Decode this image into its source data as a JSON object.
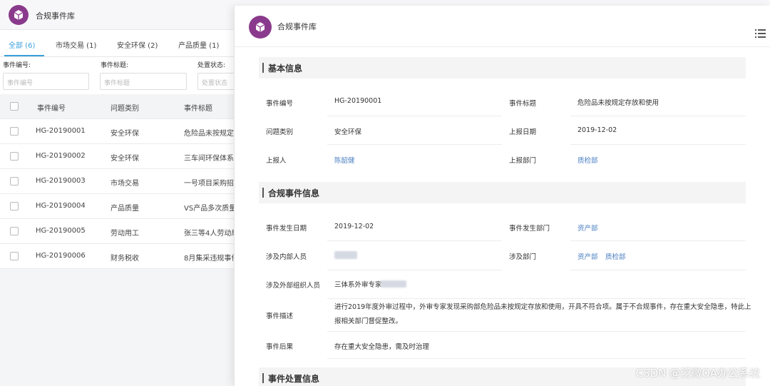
{
  "app": {
    "title": "合规事件库",
    "brand_color": "#8a3a8c",
    "accent_color": "#3aa0dc",
    "link_color": "#4a7fc1"
  },
  "tabs": [
    {
      "label": "全部 (6)",
      "active": true
    },
    {
      "label": "市场交易 (1)",
      "active": false
    },
    {
      "label": "安全环保 (2)",
      "active": false
    },
    {
      "label": "产品质量 (1)",
      "active": false
    }
  ],
  "filters": [
    {
      "label": "事件编号:",
      "placeholder": "事件编号"
    },
    {
      "label": "事件标题:",
      "placeholder": "事件标题"
    },
    {
      "label": "处置状态:",
      "placeholder": "处置状态"
    }
  ],
  "table": {
    "headers": [
      "事件编号",
      "问题类别",
      "事件标题"
    ],
    "rows": [
      [
        "HG-20190001",
        "安全环保",
        "危险品未按规定存"
      ],
      [
        "HG-20190002",
        "安全环保",
        "三车间环保体系"
      ],
      [
        "HG-20190003",
        "市场交易",
        "一号项目采购招"
      ],
      [
        "HG-20190004",
        "产品质量",
        "VS产品多次质量"
      ],
      [
        "HG-20190005",
        "劳动用工",
        "张三等4人劳动局"
      ],
      [
        "HG-20190006",
        "财务税收",
        "8月集采违规事件"
      ]
    ]
  },
  "panel": {
    "title": "合规事件库",
    "menu_icon": "list-icon",
    "sections": {
      "basic": "基本信息",
      "compliance": "合规事件信息",
      "handling": "事件处置信息"
    },
    "basic": {
      "event_no_label": "事件编号",
      "event_no": "HG-20190001",
      "event_title_label": "事件标题",
      "event_title": "危险品未按规定存放和使用",
      "category_label": "问题类别",
      "category": "安全环保",
      "report_date_label": "上报日期",
      "report_date": "2019-12-02",
      "reporter_label": "上报人",
      "reporter": "陈韶健",
      "report_dept_label": "上报部门",
      "report_dept": "质检部"
    },
    "compliance": {
      "occur_date_label": "事件发生日期",
      "occur_date": "2019-12-02",
      "occur_dept_label": "事件发生部门",
      "occur_dept": "资产部",
      "internal_label": "涉及内部人员",
      "dept_label": "涉及部门",
      "dept_1": "资产部",
      "dept_2": "质检部",
      "external_label": "涉及外部组织人员",
      "external": "三体系外审专家",
      "desc_label": "事件描述",
      "desc": "进行2019年度外审过程中，外审专家发现采购部危险品未按规定存放和使用，开具不符合项。属于不合规事件，存在重大安全隐患，特此上报相关部门督促整改。",
      "result_label": "事件后果",
      "result": "存在重大安全隐患，需及时治理"
    }
  },
  "watermark": "CSDN @泛微OA办公系统"
}
